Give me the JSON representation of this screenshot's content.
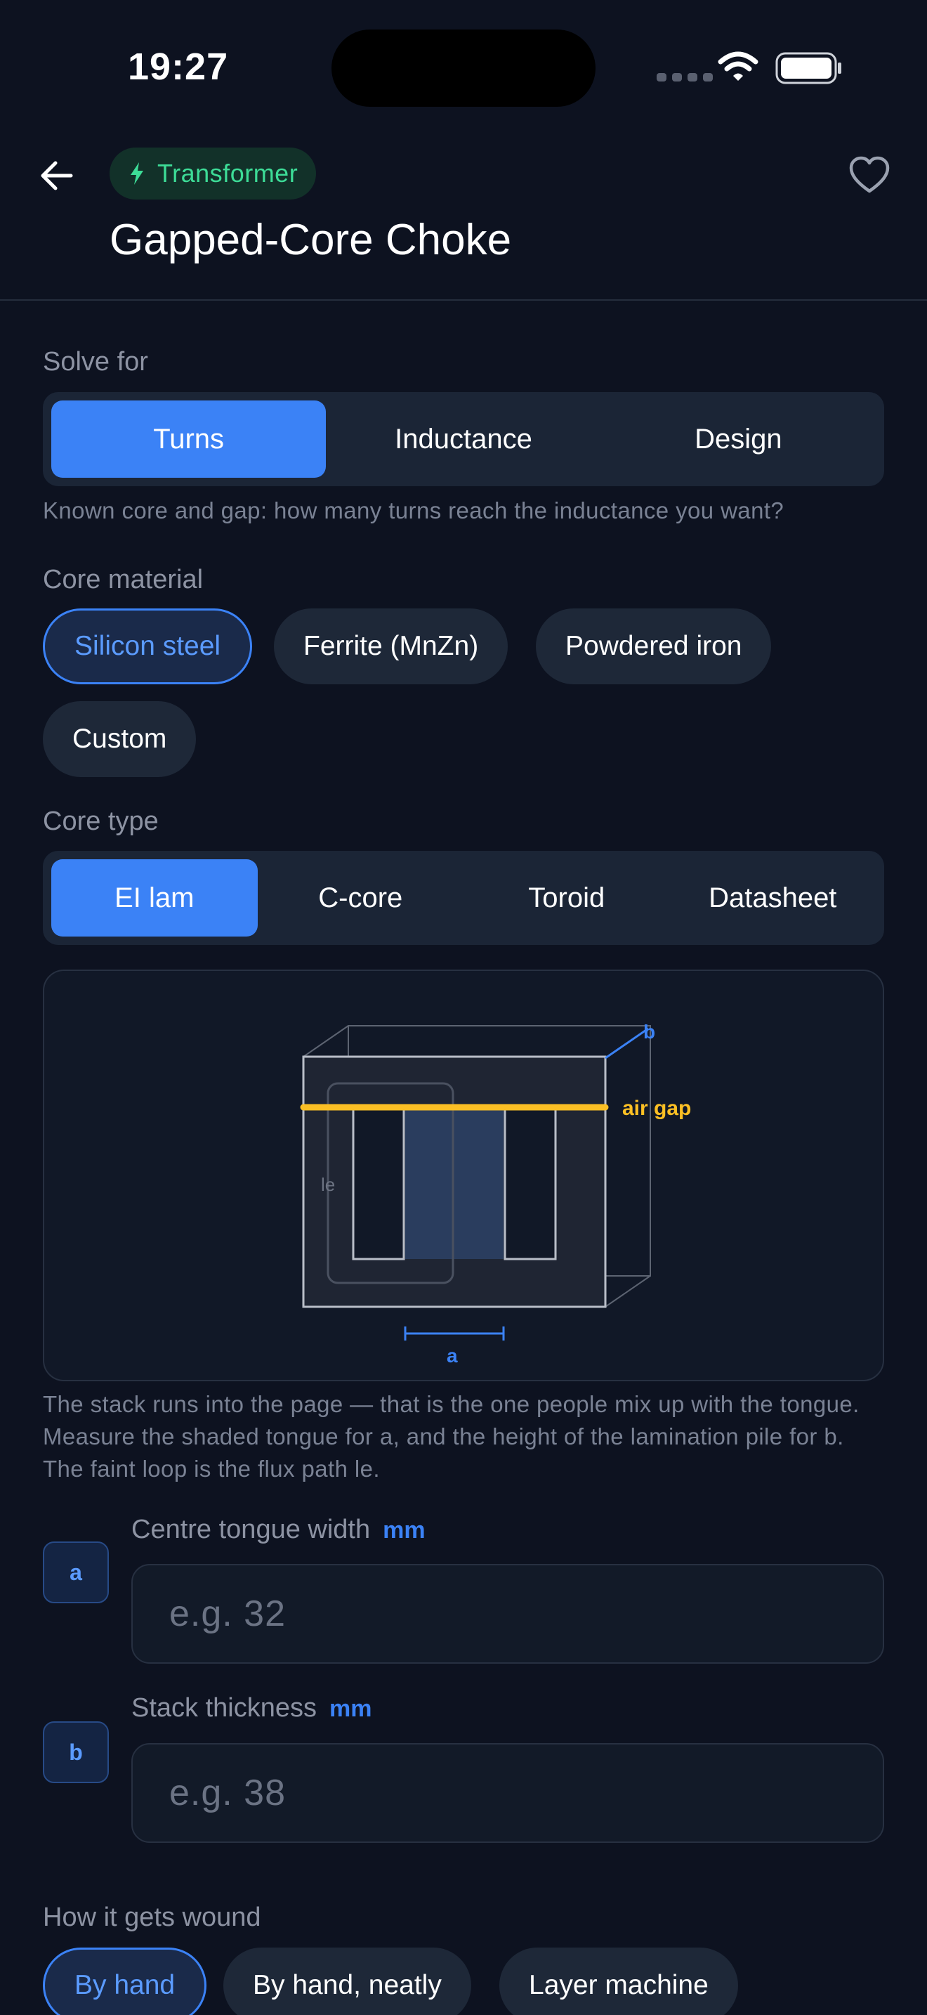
{
  "status_bar": {
    "time": "19:27"
  },
  "header": {
    "badge_label": "Transformer",
    "title": "Gapped-Core Choke"
  },
  "solve_for": {
    "label": "Solve for",
    "options": [
      "Turns",
      "Inductance",
      "Design"
    ],
    "selected": "Turns",
    "hint": "Known core and gap: how many turns reach the inductance you want?"
  },
  "core_material": {
    "label": "Core material",
    "options": [
      "Silicon steel",
      "Ferrite (MnZn)",
      "Powdered iron",
      "Custom"
    ],
    "selected": "Silicon steel"
  },
  "core_type": {
    "label": "Core type",
    "options": [
      "EI lam",
      "C-core",
      "Toroid",
      "Datasheet"
    ],
    "selected": "EI lam"
  },
  "diagram": {
    "label_air_gap": "air gap",
    "label_b": "b",
    "label_a": "a",
    "label_le": "le",
    "caption": "The stack runs into the page — that is the one people mix up with the tongue. Measure the shaded tongue for a, and the height of the lamination pile for b. The faint loop is the flux path le."
  },
  "fields": [
    {
      "key": "a",
      "label": "Centre tongue width",
      "unit": "mm",
      "placeholder": "e.g. 32"
    },
    {
      "key": "b",
      "label": "Stack thickness",
      "unit": "mm",
      "placeholder": "e.g. 38"
    }
  ],
  "winding": {
    "label": "How it gets wound",
    "options": [
      "By hand",
      "By hand, neatly",
      "Layer machine"
    ],
    "selected": "By hand"
  },
  "colors": {
    "background": "#0d1220",
    "accent": "#3b82f6",
    "badge_green": "#3ddc97",
    "air_gap": "#fbbf24"
  }
}
